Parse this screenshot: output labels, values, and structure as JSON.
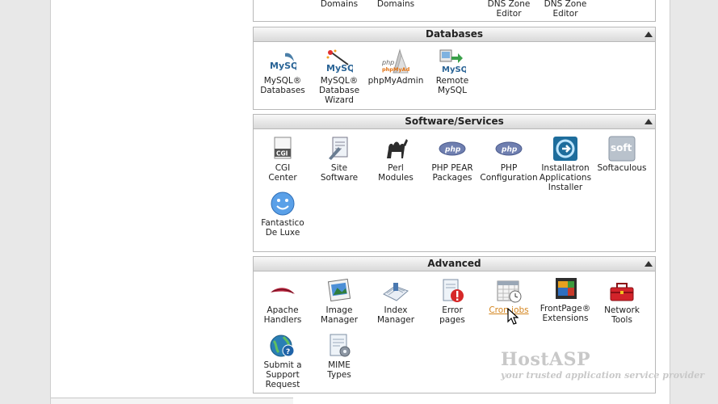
{
  "top_partial": [
    "Domains",
    "Domains",
    "DNS Zone Editor",
    "DNS Zone Editor"
  ],
  "top_partial_lines": [
    [
      "Domains"
    ],
    [
      "Domains"
    ],
    [
      "DNS Zone",
      "Editor"
    ],
    [
      "DNS Zone",
      "Editor"
    ]
  ],
  "databases": {
    "title": "Databases",
    "items": [
      {
        "l1": "MySQL®",
        "l2": "Databases",
        "l3": ""
      },
      {
        "l1": "MySQL®",
        "l2": "Database",
        "l3": "Wizard"
      },
      {
        "l1": "phpMyAdmin",
        "l2": "",
        "l3": ""
      },
      {
        "l1": "Remote",
        "l2": "MySQL",
        "l3": ""
      }
    ]
  },
  "software": {
    "title": "Software/Services",
    "items": [
      {
        "l1": "CGI",
        "l2": "Center",
        "l3": ""
      },
      {
        "l1": "Site",
        "l2": "Software",
        "l3": ""
      },
      {
        "l1": "Perl",
        "l2": "Modules",
        "l3": ""
      },
      {
        "l1": "PHP PEAR",
        "l2": "Packages",
        "l3": ""
      },
      {
        "l1": "PHP",
        "l2": "Configuration",
        "l3": ""
      },
      {
        "l1": "Installatron",
        "l2": "Applications",
        "l3": "Installer"
      },
      {
        "l1": "Softaculous",
        "l2": "",
        "l3": ""
      },
      {
        "l1": "Fantastico",
        "l2": "De Luxe",
        "l3": ""
      }
    ]
  },
  "advanced": {
    "title": "Advanced",
    "items": [
      {
        "l1": "Apache",
        "l2": "Handlers",
        "l3": ""
      },
      {
        "l1": "Image",
        "l2": "Manager",
        "l3": ""
      },
      {
        "l1": "Index",
        "l2": "Manager",
        "l3": ""
      },
      {
        "l1": "Error",
        "l2": "pages",
        "l3": ""
      },
      {
        "l1": "Cron jobs",
        "l2": "",
        "l3": ""
      },
      {
        "l1": "FrontPage®",
        "l2": "Extensions",
        "l3": ""
      },
      {
        "l1": "Network",
        "l2": "Tools",
        "l3": ""
      },
      {
        "l1": "Submit a",
        "l2": "Support",
        "l3": "Request"
      },
      {
        "l1": "MIME",
        "l2": "Types",
        "l3": ""
      }
    ]
  },
  "icon_text": {
    "mysql": "MySQL",
    "php": "php",
    "phpmyadmin": "phpMyAdmin",
    "cgi": "CGI",
    "soft": "soft"
  },
  "watermark": {
    "line1": "HostASP",
    "line2": "your trusted application service provider"
  },
  "colors": {
    "link": "#d4841c",
    "header_bg": "#dcdcdc"
  }
}
